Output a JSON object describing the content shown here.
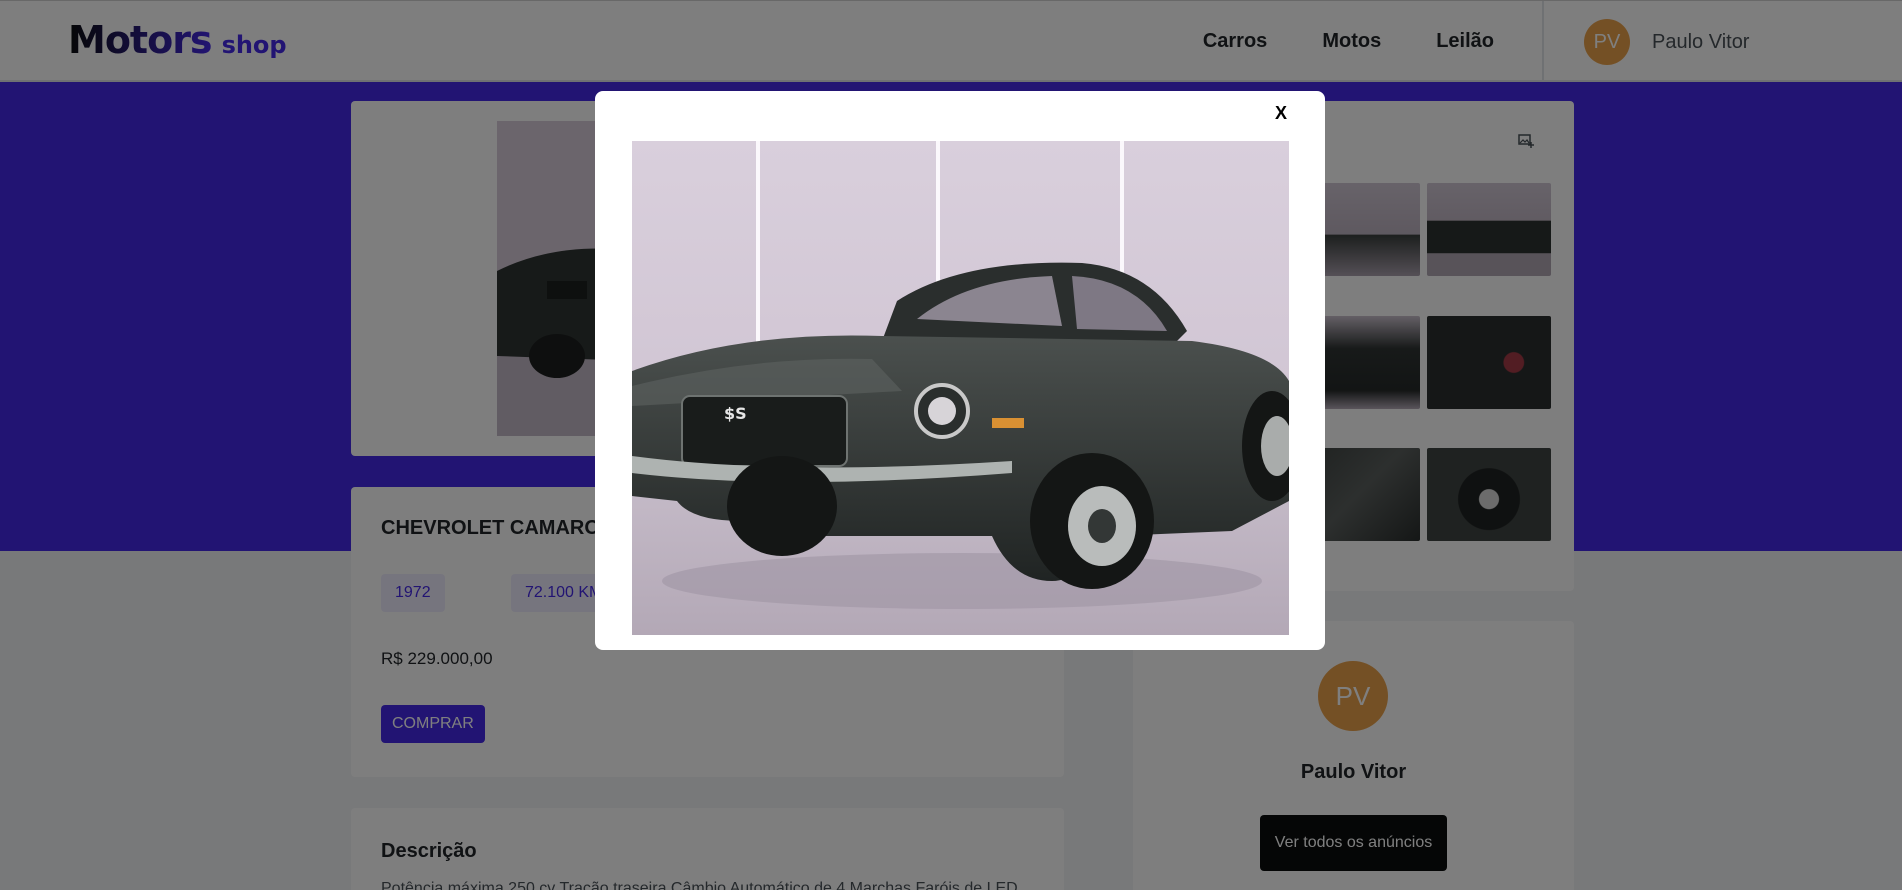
{
  "header": {
    "logo_main": "Motors",
    "logo_sub": "shop",
    "nav": [
      "Carros",
      "Motos",
      "Leilão"
    ],
    "user": {
      "initials": "PV",
      "name": "Paulo Vitor"
    }
  },
  "car": {
    "title": "CHEVROLET CAMARO",
    "year": "1972",
    "mileage": "72.100 KM",
    "price": "R$ 229.000,00",
    "buy_label": "COMPRAR"
  },
  "description": {
    "title": "Descrição",
    "text": "Potência máxima 250 cv Tração traseira Câmbio Automático de 4 Marchas Faróis de LED"
  },
  "seller": {
    "initials": "PV",
    "name": "Paulo Vitor",
    "button_label": "Ver todos os anúncios"
  },
  "modal": {
    "close_label": "X"
  },
  "colors": {
    "brand": "#4529e6",
    "avatar": "#e9a14a",
    "overlay": "rgba(0,0,0,0.5)"
  },
  "icons": {
    "photos": "add-photo-icon"
  }
}
